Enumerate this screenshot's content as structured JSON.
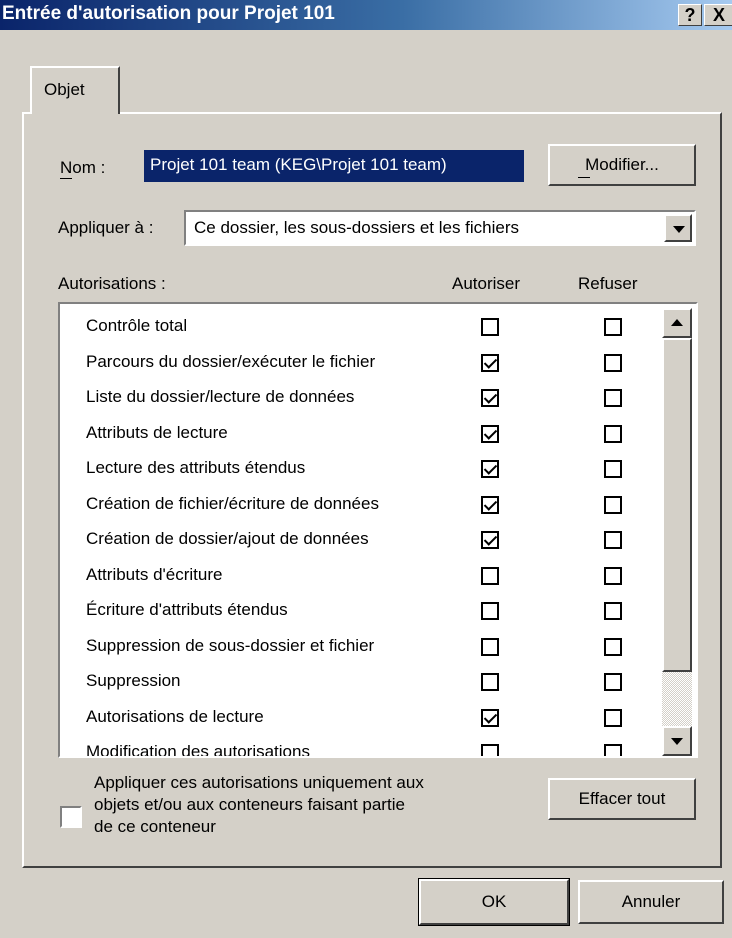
{
  "window": {
    "title": "Entrée d'autorisation pour Projet 101",
    "help_label": "?",
    "close_label": "X"
  },
  "tab": {
    "label": "Objet"
  },
  "name_field": {
    "label": "Nom :",
    "value": "Projet 101 team (KEG\\Projet 101 team)",
    "modify_button": "Modifier..."
  },
  "apply_to": {
    "label": "Appliquer à :",
    "value": "Ce dossier, les sous-dossiers et les fichiers"
  },
  "permissions": {
    "header_label": "Autorisations :",
    "allow_header": "Autoriser",
    "deny_header": "Refuser",
    "items": [
      {
        "label": "Contrôle total",
        "allow": false,
        "deny": false
      },
      {
        "label": "Parcours du dossier/exécuter le fichier",
        "allow": true,
        "deny": false
      },
      {
        "label": "Liste du dossier/lecture de données",
        "allow": true,
        "deny": false
      },
      {
        "label": "Attributs de lecture",
        "allow": true,
        "deny": false
      },
      {
        "label": "Lecture des attributs étendus",
        "allow": true,
        "deny": false
      },
      {
        "label": "Création de fichier/écriture de données",
        "allow": true,
        "deny": false
      },
      {
        "label": "Création de dossier/ajout de données",
        "allow": true,
        "deny": false
      },
      {
        "label": "Attributs d'écriture",
        "allow": false,
        "deny": false
      },
      {
        "label": "Écriture d'attributs étendus",
        "allow": false,
        "deny": false
      },
      {
        "label": "Suppression de sous-dossier et fichier",
        "allow": false,
        "deny": false
      },
      {
        "label": "Suppression",
        "allow": false,
        "deny": false
      },
      {
        "label": "Autorisations de lecture",
        "allow": true,
        "deny": false
      },
      {
        "label": "Modification des autorisations",
        "allow": false,
        "deny": false
      }
    ]
  },
  "apply_only": {
    "line1": "Appliquer ces autorisations uniquement aux",
    "line2": "objets et/ou aux conteneurs faisant partie",
    "line3": "de ce conteneur",
    "checked": false
  },
  "clear_all_button": "Effacer tout",
  "ok_button": "OK",
  "cancel_button": "Annuler"
}
